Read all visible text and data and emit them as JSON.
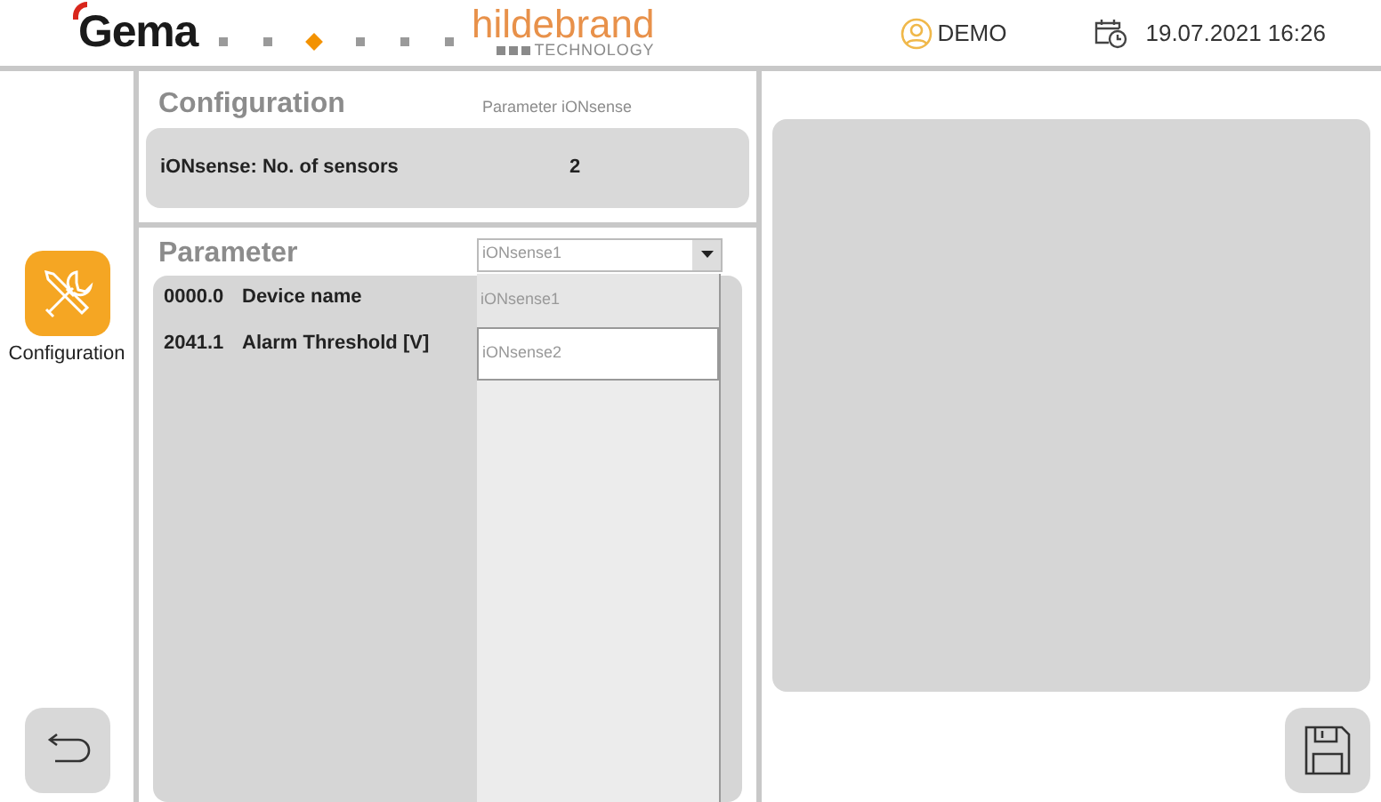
{
  "header": {
    "logo": "Gema",
    "page_dots": [
      {
        "selected": false
      },
      {
        "selected": false
      },
      {
        "selected": true
      },
      {
        "selected": false
      },
      {
        "selected": false
      },
      {
        "selected": false
      }
    ],
    "brand": {
      "name": "hildebrand",
      "tagline": "TECHNOLOGY"
    },
    "user": "DEMO",
    "datetime": "19.07.2021 16:26"
  },
  "sidebar": {
    "items": [
      {
        "label": "Configuration",
        "selected": true
      }
    ]
  },
  "configuration": {
    "title": "Configuration",
    "subtitle": "Parameter iONsense",
    "rows": [
      {
        "label": "iONsense: No. of sensors",
        "value": "2"
      }
    ]
  },
  "parameter": {
    "title": "Parameter",
    "dropdown": {
      "value": "iONsense1",
      "expanded": true,
      "options": [
        {
          "label": "iONsense1",
          "selected": true
        },
        {
          "label": "iONsense2",
          "selected": false
        }
      ]
    },
    "rows": [
      {
        "code": "0000.0",
        "label": "Device name"
      },
      {
        "code": "2041.1",
        "label": "Alarm Threshold [V]"
      }
    ]
  }
}
